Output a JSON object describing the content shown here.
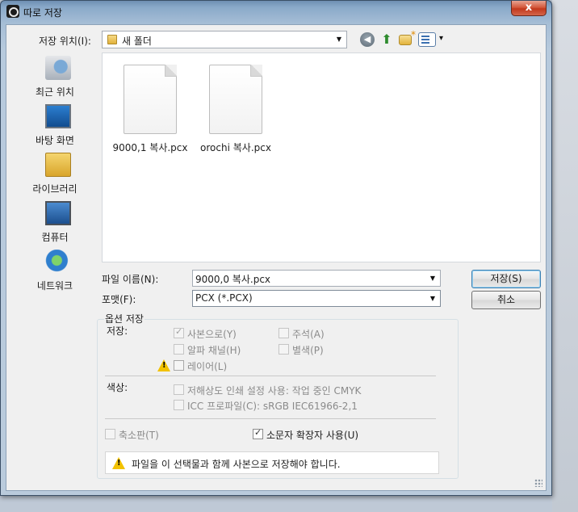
{
  "window": {
    "title": "따로 저장",
    "close_label": "x"
  },
  "location": {
    "label": "저장 위치(I):",
    "value": "새 폴더"
  },
  "places": [
    {
      "label": "최근 위치",
      "icon": "recent-places-icon"
    },
    {
      "label": "바탕 화면",
      "icon": "desktop-icon"
    },
    {
      "label": "라이브러리",
      "icon": "library-icon"
    },
    {
      "label": "컴퓨터",
      "icon": "computer-icon"
    },
    {
      "label": "네트워크",
      "icon": "network-icon"
    }
  ],
  "files": [
    {
      "name": "9000,1 복사.pcx"
    },
    {
      "name": "orochi 복사.pcx"
    }
  ],
  "filename": {
    "label": "파일 이름(N):",
    "value": "9000,0 복사.pcx"
  },
  "format": {
    "label": "포맷(F):",
    "value": "PCX (*.PCX)"
  },
  "buttons": {
    "save": "저장(S)",
    "cancel": "취소"
  },
  "options": {
    "group_label": "옵션 저장",
    "save_label": "저장:",
    "as_copy": "사본으로(Y)",
    "annotations": "주석(A)",
    "alpha_channels": "알파 채널(H)",
    "spot_colors": "별색(P)",
    "layers": "레이어(L)",
    "color_label": "색상:",
    "proof_setup": "저해상도 인쇄 설정 사용: 작업 중인 CMYK",
    "icc_profile": "ICC 프로파일(C): sRGB IEC61966-2,1",
    "thumbnail": "축소판(T)",
    "lowercase_ext": "소문자 확장자 사용(U)",
    "warning": "파일을 이 선택물과 함께 사본으로 저장해야 합니다."
  }
}
